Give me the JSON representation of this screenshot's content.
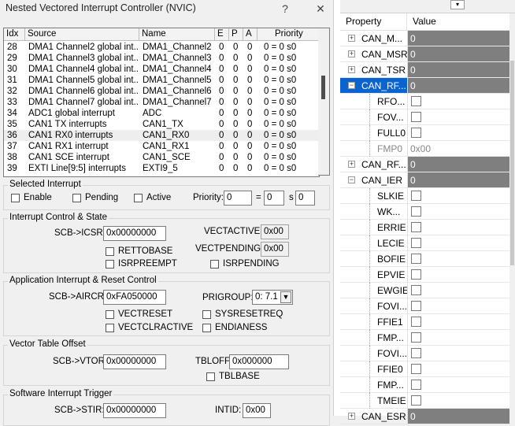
{
  "dialog": {
    "title": "Nested Vectored Interrupt Controller (NVIC)",
    "help_label": "?",
    "close_label": "✕"
  },
  "table": {
    "headers": [
      "Idx",
      "Source",
      "Name",
      "E",
      "P",
      "A",
      "Priority"
    ],
    "rows": [
      {
        "idx": "28",
        "source": "DMA1 Channel2 global int...",
        "name": "DMA1_Channel2",
        "e": "0",
        "p": "0",
        "a": "0",
        "priority": "0 = 0 s0"
      },
      {
        "idx": "29",
        "source": "DMA1 Channel3 global int...",
        "name": "DMA1_Channel3",
        "e": "0",
        "p": "0",
        "a": "0",
        "priority": "0 = 0 s0"
      },
      {
        "idx": "30",
        "source": "DMA1 Channel4 global int...",
        "name": "DMA1_Channel4",
        "e": "0",
        "p": "0",
        "a": "0",
        "priority": "0 = 0 s0"
      },
      {
        "idx": "31",
        "source": "DMA1 Channel5 global int...",
        "name": "DMA1_Channel5",
        "e": "0",
        "p": "0",
        "a": "0",
        "priority": "0 = 0 s0"
      },
      {
        "idx": "32",
        "source": "DMA1 Channel6 global int...",
        "name": "DMA1_Channel6",
        "e": "0",
        "p": "0",
        "a": "0",
        "priority": "0 = 0 s0"
      },
      {
        "idx": "33",
        "source": "DMA1 Channel7 global int...",
        "name": "DMA1_Channel7",
        "e": "0",
        "p": "0",
        "a": "0",
        "priority": "0 = 0 s0"
      },
      {
        "idx": "34",
        "source": "ADC1 global interrupt",
        "name": "ADC",
        "e": "0",
        "p": "0",
        "a": "0",
        "priority": "0 = 0 s0"
      },
      {
        "idx": "35",
        "source": "CAN1 TX interrupts",
        "name": "CAN1_TX",
        "e": "0",
        "p": "0",
        "a": "0",
        "priority": "0 = 0 s0"
      },
      {
        "idx": "36",
        "source": "CAN1 RX0 interrupts",
        "name": "CAN1_RX0",
        "e": "0",
        "p": "0",
        "a": "0",
        "priority": "0 = 0 s0",
        "selected": true
      },
      {
        "idx": "37",
        "source": "CAN1 RX1 interrupt",
        "name": "CAN1_RX1",
        "e": "0",
        "p": "0",
        "a": "0",
        "priority": "0 = 0 s0"
      },
      {
        "idx": "38",
        "source": "CAN1 SCE interrupt",
        "name": "CAN1_SCE",
        "e": "0",
        "p": "0",
        "a": "0",
        "priority": "0 = 0 s0"
      },
      {
        "idx": "39",
        "source": "EXTI Line[9:5] interrupts",
        "name": "EXTI9_5",
        "e": "0",
        "p": "0",
        "a": "0",
        "priority": "0 = 0 s0"
      }
    ]
  },
  "selected_interrupt": {
    "title": "Selected Interrupt",
    "enable_label": "Enable",
    "pending_label": "Pending",
    "active_label": "Active",
    "priority_label": "Priority:",
    "priority_value": "0",
    "eq_label": "=",
    "group_value": "0",
    "s_label": "s",
    "sub_value": "0"
  },
  "icsr": {
    "title": "Interrupt Control & State",
    "icsr_label": "SCB->ICSR:",
    "icsr_value": "0x00000000",
    "vectactive_label": "VECTACTIVE:",
    "vectactive_value": "0x00",
    "vectpending_label": "VECTPENDING:",
    "vectpending_value": "0x00",
    "rettobase_label": "RETTOBASE",
    "isrpreempt_label": "ISRPREEMPT",
    "isrpending_label": "ISRPENDING"
  },
  "aircr": {
    "title": "Application Interrupt & Reset Control",
    "aircr_label": "SCB->AIRCR:",
    "aircr_value": "0xFA050000",
    "prigroup_label": "PRIGROUP:",
    "prigroup_value": "0: 7.1",
    "vectreset_label": "VECTRESET",
    "sysresetreq_label": "SYSRESETREQ",
    "vectclractive_label": "VECTCLRACTIVE",
    "endianess_label": "ENDIANESS"
  },
  "vtor": {
    "title": "Vector Table Offset",
    "vtor_label": "SCB->VTOR:",
    "vtor_value": "0x00000000",
    "tbloff_label": "TBLOFF:",
    "tbloff_value": "0x000000",
    "tblbase_label": "TBLBASE"
  },
  "stir": {
    "title": "Software Interrupt Trigger",
    "stir_label": "SCB->STIR:",
    "stir_value": "0x00000000",
    "intid_label": "INTID:",
    "intid_value": "0x00"
  },
  "properties": {
    "header_property": "Property",
    "header_value": "Value",
    "rows": [
      {
        "name": "CAN_M...",
        "value": "0",
        "kind": "group",
        "expander": "+"
      },
      {
        "name": "CAN_MSR",
        "value": "0",
        "kind": "group",
        "expander": "+"
      },
      {
        "name": "CAN_TSR",
        "value": "0",
        "kind": "group",
        "expander": "+"
      },
      {
        "name": "CAN_RF...",
        "value": "0",
        "kind": "group",
        "expander": "−",
        "highlighted": true
      },
      {
        "name": "RFO...",
        "value": "",
        "kind": "check"
      },
      {
        "name": "FOV...",
        "value": "",
        "kind": "check"
      },
      {
        "name": "FULL0",
        "value": "",
        "kind": "check"
      },
      {
        "name": "FMP0",
        "value": "0x00",
        "kind": "readonly"
      },
      {
        "name": "CAN_RF...",
        "value": "0",
        "kind": "group",
        "expander": "+"
      },
      {
        "name": "CAN_IER",
        "value": "0",
        "kind": "group",
        "expander": "−"
      },
      {
        "name": "SLKIE",
        "value": "",
        "kind": "check"
      },
      {
        "name": "WK...",
        "value": "",
        "kind": "check"
      },
      {
        "name": "ERRIE",
        "value": "",
        "kind": "check"
      },
      {
        "name": "LECIE",
        "value": "",
        "kind": "check"
      },
      {
        "name": "BOFIE",
        "value": "",
        "kind": "check"
      },
      {
        "name": "EPVIE",
        "value": "",
        "kind": "check"
      },
      {
        "name": "EWGIE",
        "value": "",
        "kind": "check"
      },
      {
        "name": "FOVI...",
        "value": "",
        "kind": "check"
      },
      {
        "name": "FFIE1",
        "value": "",
        "kind": "check"
      },
      {
        "name": "FMP...",
        "value": "",
        "kind": "check"
      },
      {
        "name": "FOVI...",
        "value": "",
        "kind": "check"
      },
      {
        "name": "FFIE0",
        "value": "",
        "kind": "check"
      },
      {
        "name": "FMP...",
        "value": "",
        "kind": "check"
      },
      {
        "name": "TMEIE",
        "value": "",
        "kind": "check"
      },
      {
        "name": "CAN_ESR",
        "value": "0",
        "kind": "group",
        "expander": "+"
      }
    ]
  }
}
